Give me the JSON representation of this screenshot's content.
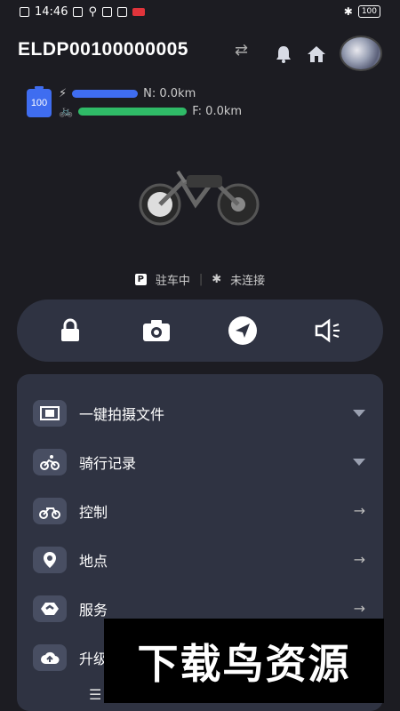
{
  "status_bar": {
    "time": "14:46",
    "battery": "100"
  },
  "header": {
    "device_id": "ELDP00100000005"
  },
  "battery": {
    "level": "100"
  },
  "ranges": [
    {
      "label": "N: 0.0km",
      "color": "#3f6df0"
    },
    {
      "label": "F: 0.0km",
      "color": "#2fba67"
    }
  ],
  "status": {
    "parking": "驻车中",
    "bluetooth": "未连接"
  },
  "actions": [
    "lock-icon",
    "camera-icon",
    "navigate-icon",
    "speaker-icon"
  ],
  "menu": [
    {
      "label": "一键拍摄文件",
      "icon": "film-icon",
      "trail": "dropdown"
    },
    {
      "label": "骑行记录",
      "icon": "cyclist-icon",
      "trail": "dropdown"
    },
    {
      "label": "控制",
      "icon": "motorbike-icon",
      "trail": "arrow"
    },
    {
      "label": "地点",
      "icon": "location-icon",
      "trail": "arrow"
    },
    {
      "label": "服务",
      "icon": "service-icon",
      "trail": "arrow"
    },
    {
      "label": "升级",
      "icon": "upload-cloud-icon",
      "trail": "arrow"
    }
  ],
  "watermark": {
    "text": "下载鸟资源"
  },
  "colors": {
    "background": "#1c1c22",
    "card": "#2f3342",
    "accent": "#3f6df0",
    "green": "#2fba67"
  }
}
